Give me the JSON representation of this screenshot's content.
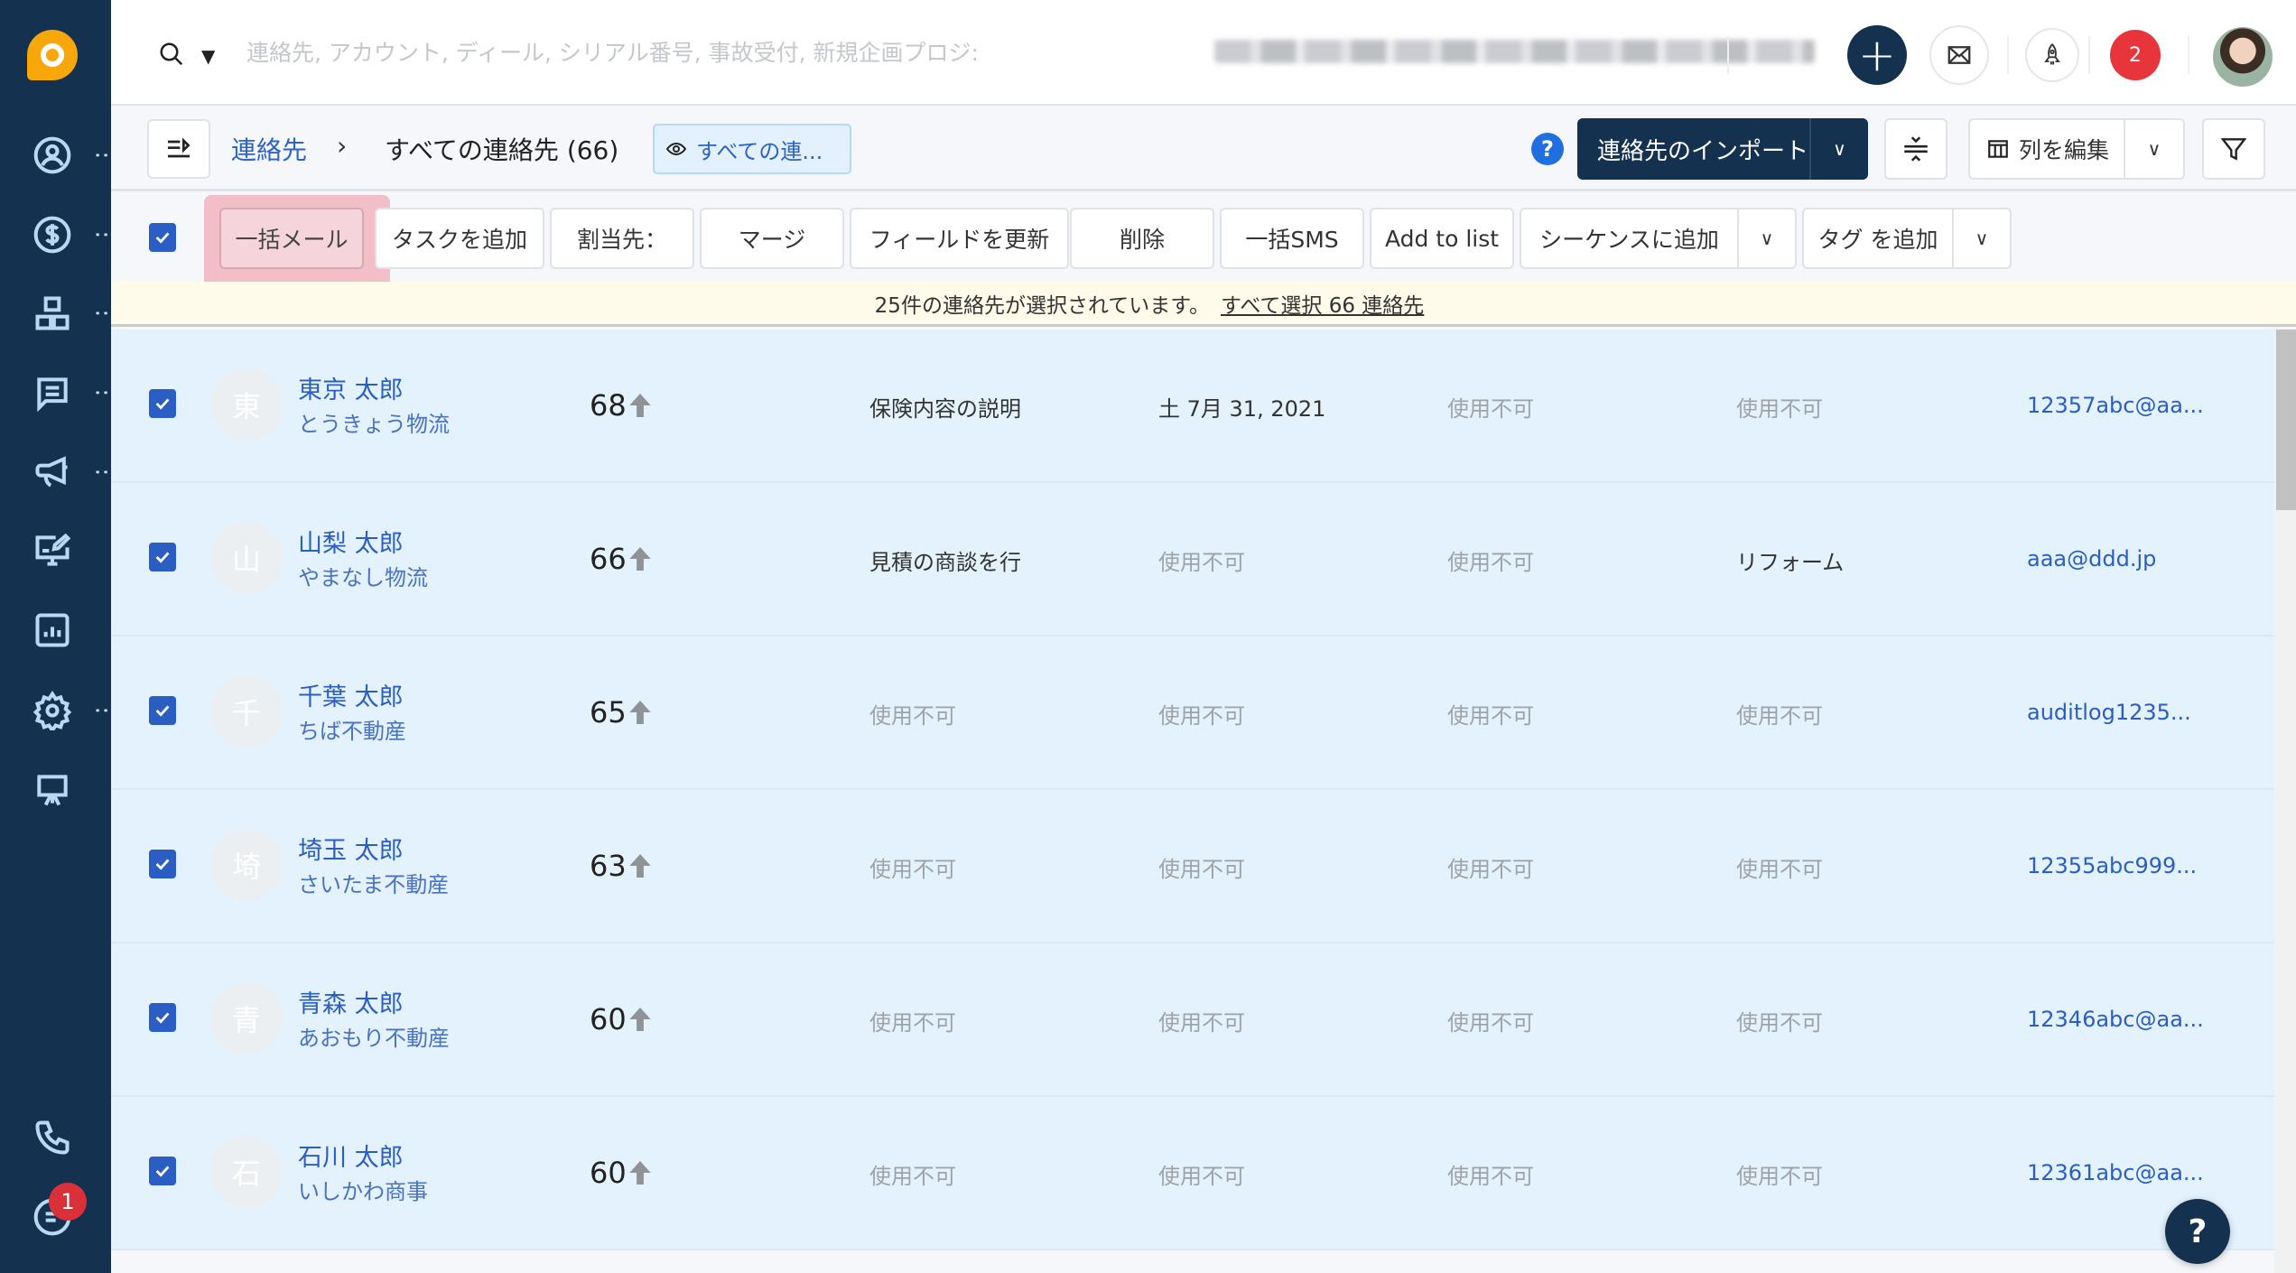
{
  "search": {
    "placeholder": "連絡先, アカウント, ディール, シリアル番号, 事故受付, 新規企画プロジ:",
    "value": ""
  },
  "header": {
    "notification_count": "2",
    "plus_label": "+",
    "help_fab": "?"
  },
  "sidebar": {
    "items": [
      {
        "icon": "contacts-icon",
        "has_menu": true
      },
      {
        "icon": "dollar-icon",
        "has_menu": true
      },
      {
        "icon": "hierarchy-icon",
        "has_menu": true
      },
      {
        "icon": "chat-icon",
        "has_menu": true
      },
      {
        "icon": "megaphone-icon",
        "has_menu": true
      },
      {
        "icon": "monitor-edit-icon",
        "has_menu": false
      },
      {
        "icon": "analytics-icon",
        "has_menu": false
      },
      {
        "icon": "gear-icon",
        "has_menu": true
      },
      {
        "icon": "presentation-icon",
        "has_menu": false
      }
    ],
    "bottom": [
      {
        "icon": "phone-icon"
      },
      {
        "icon": "feed-icon",
        "badge": "1"
      }
    ]
  },
  "breadcrumb": {
    "root": "連絡先",
    "separator": "›",
    "current": "すべての連絡先 (66)"
  },
  "view_chip": "すべての連...",
  "toolbar": {
    "help": "?",
    "import_label": "連絡先のインポート",
    "edit_columns_label": "列を編集"
  },
  "actions": [
    {
      "label": "一括メール",
      "highlighted": true
    },
    {
      "label": "タスクを追加"
    },
    {
      "label": "割当先："
    },
    {
      "label": "マージ"
    },
    {
      "label": "フィールドを更新"
    },
    {
      "label": "削除"
    },
    {
      "label": "一括SMS"
    },
    {
      "label": "Add to list"
    },
    {
      "label": "シーケンスに追加",
      "dropdown": true
    },
    {
      "label": "タグ を追加",
      "dropdown": true
    }
  ],
  "selection_banner": {
    "text": "25件の連絡先が選択されています。",
    "link": "すべて選択 66 連絡先"
  },
  "rows": [
    {
      "initial": "東",
      "name": "東京 太郎",
      "company": "とうきょう物流",
      "score": "68",
      "col1": "保険内容の説明",
      "col1_na": false,
      "col2": "土 7月 31, 2021",
      "col2_na": false,
      "col3": "使用不可",
      "col3_na": true,
      "col4": "使用不可",
      "col4_na": true,
      "email": "12357abc@aa...",
      "checked": true
    },
    {
      "initial": "山",
      "name": "山梨 太郎",
      "company": "やまなし物流",
      "score": "66",
      "col1": "見積の商談を行",
      "col1_na": false,
      "col2": "使用不可",
      "col2_na": true,
      "col3": "使用不可",
      "col3_na": true,
      "col4": "リフォーム",
      "col4_na": false,
      "email": "aaa@ddd.jp",
      "checked": true
    },
    {
      "initial": "千",
      "name": "千葉 太郎",
      "company": "ちば不動産",
      "score": "65",
      "col1": "使用不可",
      "col1_na": true,
      "col2": "使用不可",
      "col2_na": true,
      "col3": "使用不可",
      "col3_na": true,
      "col4": "使用不可",
      "col4_na": true,
      "email": "auditlog1235...",
      "checked": true
    },
    {
      "initial": "埼",
      "name": "埼玉 太郎",
      "company": "さいたま不動産",
      "score": "63",
      "col1": "使用不可",
      "col1_na": true,
      "col2": "使用不可",
      "col2_na": true,
      "col3": "使用不可",
      "col3_na": true,
      "col4": "使用不可",
      "col4_na": true,
      "email": "12355abc999...",
      "checked": true
    },
    {
      "initial": "青",
      "name": "青森 太郎",
      "company": "あおもり不動産",
      "score": "60",
      "col1": "使用不可",
      "col1_na": true,
      "col2": "使用不可",
      "col2_na": true,
      "col3": "使用不可",
      "col3_na": true,
      "col4": "使用不可",
      "col4_na": true,
      "email": "12346abc@aa...",
      "checked": true
    },
    {
      "initial": "石",
      "name": "石川 太郎",
      "company": "いしかわ商事",
      "score": "60",
      "col1": "使用不可",
      "col1_na": true,
      "col2": "使用不可",
      "col2_na": true,
      "col3": "使用不可",
      "col3_na": true,
      "col4": "使用不可",
      "col4_na": true,
      "email": "12361abc@aa...",
      "checked": true
    }
  ],
  "colors": {
    "sidebar_bg": "#14324f",
    "accent_blue": "#2b5ec2",
    "brand_orange": "#f7a70a",
    "row_selected_bg": "#e3f2fd",
    "banner_bg": "#fffbea",
    "badge_red": "#e8343b",
    "highlight_pink": "#f0788c"
  }
}
